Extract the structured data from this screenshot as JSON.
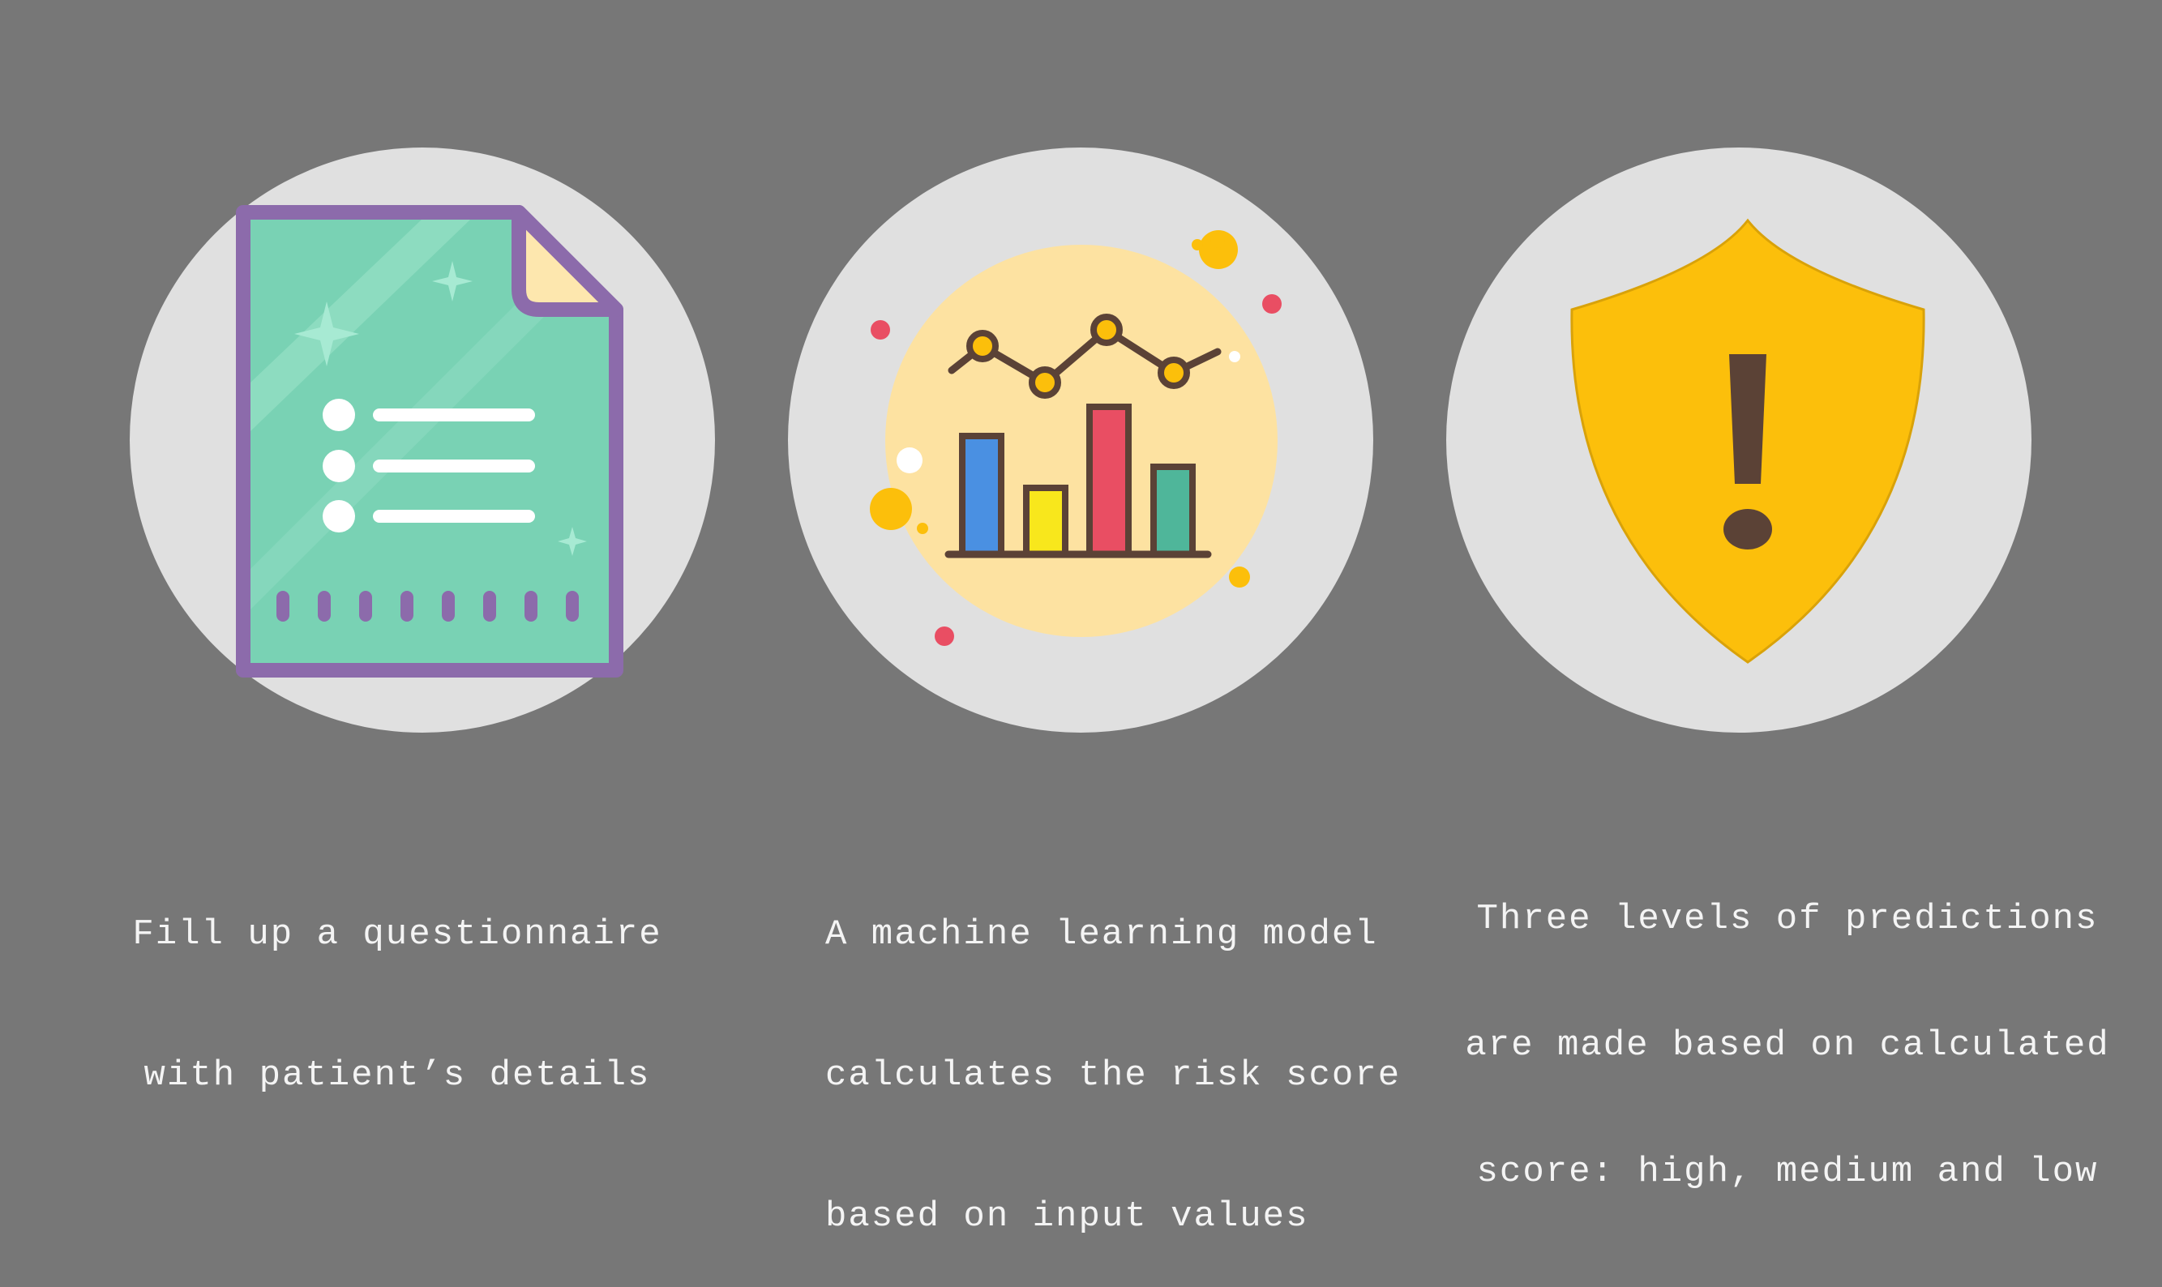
{
  "steps": [
    {
      "icon": "questionnaire-document-icon",
      "caption_lines": [
        "Fill up a questionnaire",
        "with patient’s details"
      ]
    },
    {
      "icon": "analytics-chart-icon",
      "caption_lines": [
        "A machine learning model",
        "calculates the risk score",
        "based on input values"
      ]
    },
    {
      "icon": "warning-shield-icon",
      "caption_lines": [
        "Three levels of predictions",
        "are made based on calculated",
        "score: high, medium and low"
      ]
    }
  ],
  "colors": {
    "background": "#777777",
    "circle": "#e0e0e0",
    "caption_text": "#f4f4f4",
    "document_green": "#79d2b4",
    "document_border": "#8c6bab",
    "chart_background": "#fde2a1",
    "bar_blue": "#4a90e2",
    "bar_yellow": "#f8e71c",
    "bar_red": "#e94e63",
    "bar_teal": "#4fb69a",
    "shield_yellow": "#fcbf0b",
    "exclamation_brown": "#5b4236"
  }
}
